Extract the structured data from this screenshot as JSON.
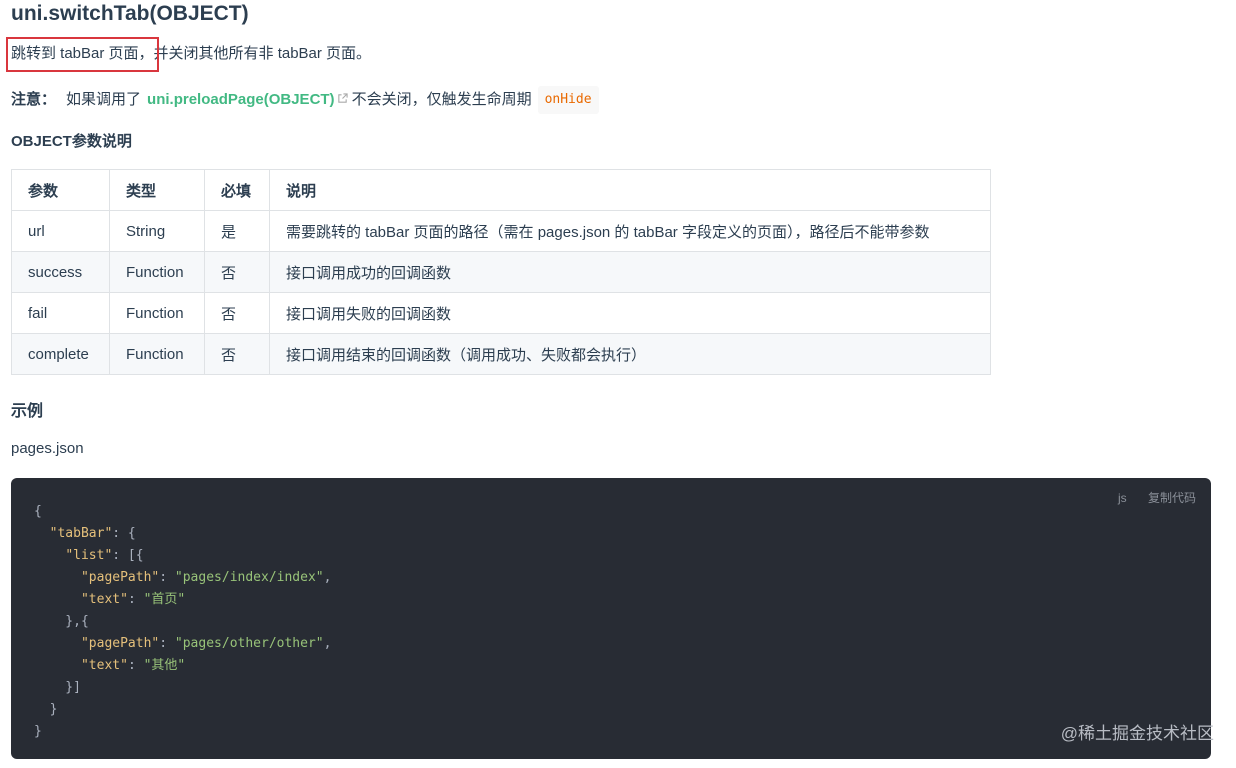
{
  "heading": "uni.switchTab(OBJECT)",
  "intro": {
    "highlighted": "跳转到 tabBar 页面，",
    "rest": "并关闭其他所有非 tabBar 页面。"
  },
  "note": {
    "label": "注意：",
    "before_link": "如果调用了",
    "link": "uni.preloadPage(OBJECT)",
    "after_link": "不会关闭，仅触发生命周期",
    "code": "onHide"
  },
  "params_heading": "OBJECT参数说明",
  "table": {
    "headers": [
      "参数",
      "类型",
      "必填",
      "说明"
    ],
    "rows": [
      [
        "url",
        "String",
        "是",
        "需要跳转的 tabBar 页面的路径（需在 pages.json 的 tabBar 字段定义的页面），路径后不能带参数"
      ],
      [
        "success",
        "Function",
        "否",
        "接口调用成功的回调函数"
      ],
      [
        "fail",
        "Function",
        "否",
        "接口调用失败的回调函数"
      ],
      [
        "complete",
        "Function",
        "否",
        "接口调用结束的回调函数（调用成功、失败都会执行）"
      ]
    ]
  },
  "example_heading": "示例",
  "file_label": "pages.json",
  "code": {
    "lang": "js",
    "copy_label": "复制代码",
    "lines": [
      "{",
      "  \"tabBar\": {",
      "    \"list\": [{",
      "      \"pagePath\": \"pages/index/index\",",
      "      \"text\": \"首页\"",
      "    },{",
      "      \"pagePath\": \"pages/other/other\",",
      "      \"text\": \"其他\"",
      "    }]",
      "  }",
      "}"
    ]
  },
  "watermark": "@稀土掘金技术社区",
  "colors": {
    "link": "#42b983",
    "highlight_border": "#d9363e",
    "code_bg": "#282c34",
    "inline_code": "#e96900"
  }
}
